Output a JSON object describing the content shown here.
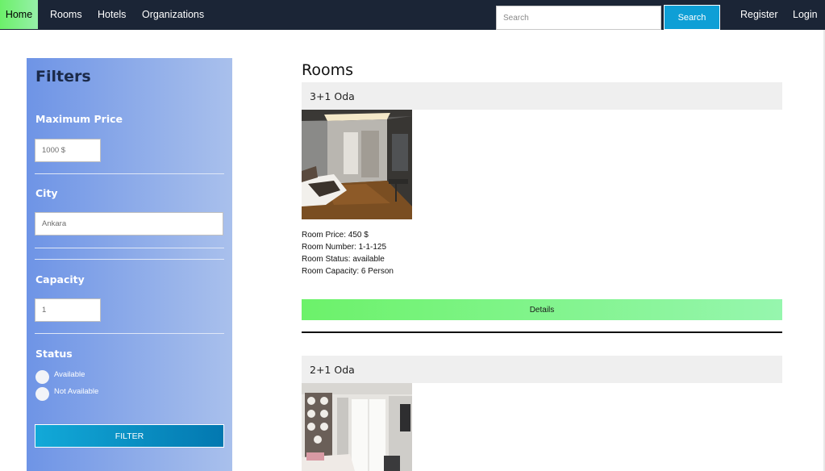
{
  "navbar": {
    "home": "Home",
    "rooms": "Rooms",
    "hotels": "Hotels",
    "organizations": "Organizations",
    "search_placeholder": "Search",
    "search_button": "Search",
    "register": "Register",
    "login": "Login",
    "active_color": "#6cf06a",
    "background": "#1b2536"
  },
  "filters": {
    "title": "Filters",
    "max_price_label": "Maximum Price",
    "max_price_placeholder": "1000 $",
    "city_label": "City",
    "city_placeholder": "Ankara",
    "capacity_label": "Capacity",
    "capacity_placeholder": "1",
    "status_label": "Status",
    "status_options": [
      "Available",
      "Not Available"
    ],
    "filter_button": "FILTER"
  },
  "rooms": {
    "heading": "Rooms",
    "items": [
      {
        "name": "3+1 Oda",
        "price": "Room Price: 450 $",
        "number": "Room Number: 1-1-125",
        "status": "Room Status: available",
        "capacity": "Room Capacity: 6 Person",
        "details_button": "Details"
      },
      {
        "name": "2+1 Oda"
      }
    ]
  }
}
